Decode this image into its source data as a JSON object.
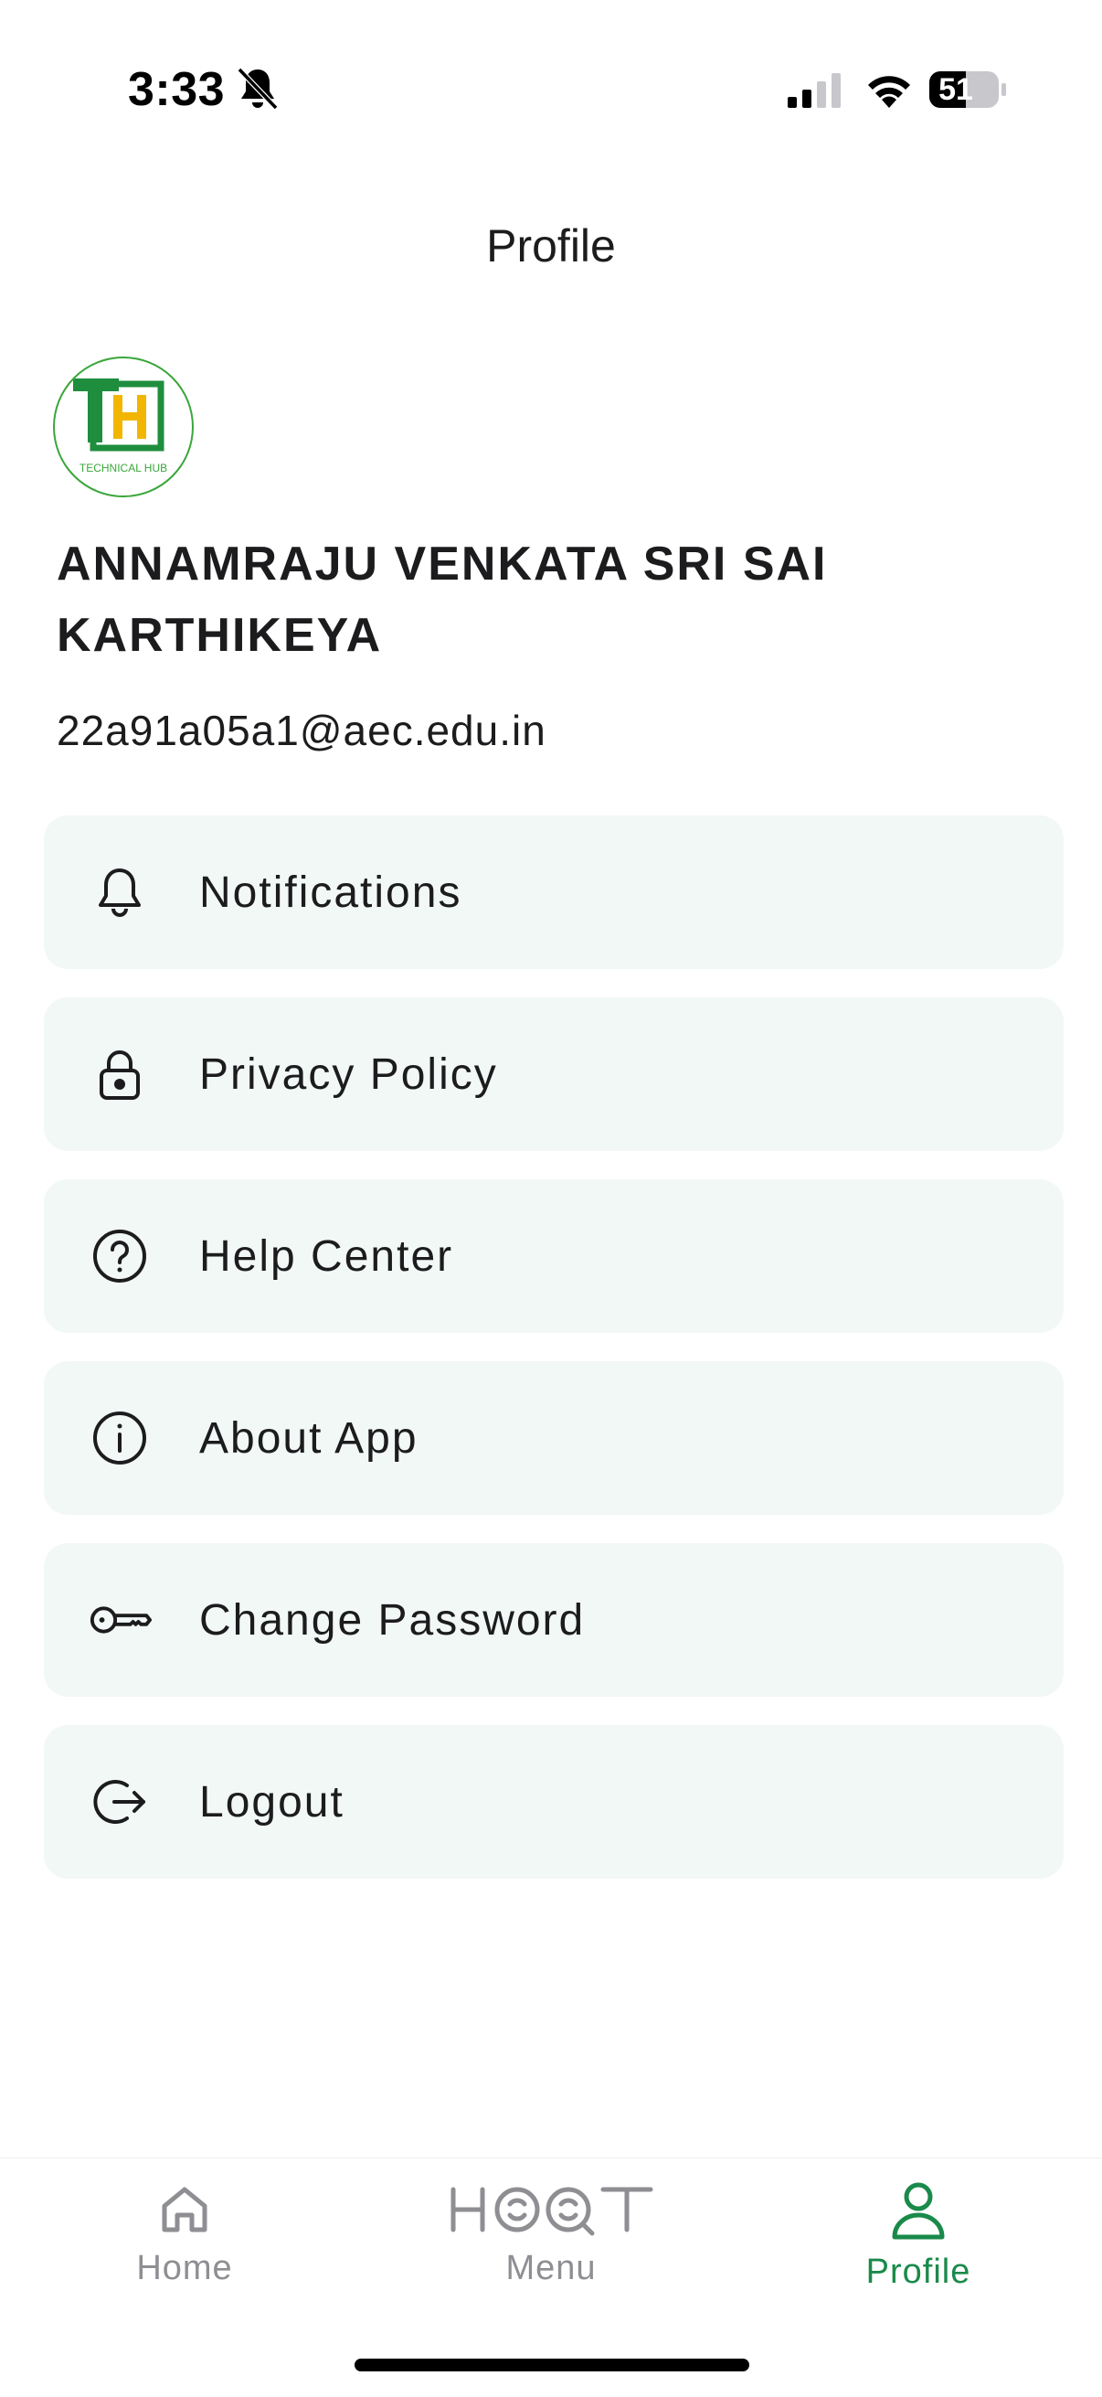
{
  "status_bar": {
    "time": "3:33",
    "battery": "51"
  },
  "header": {
    "title": "Profile"
  },
  "profile": {
    "avatar_logo_text": "TH",
    "avatar_subtext": "TECHNICAL HUB",
    "name": "ANNAMRAJU VENKATA SRI SAI KARTHIKEYA",
    "email": "22a91a05a1@aec.edu.in"
  },
  "menu": {
    "items": [
      {
        "label": "Notifications",
        "icon": "bell-icon"
      },
      {
        "label": "Privacy Policy",
        "icon": "lock-icon"
      },
      {
        "label": "Help Center",
        "icon": "help-circle-icon"
      },
      {
        "label": "About App",
        "icon": "info-icon"
      },
      {
        "label": "Change Password",
        "icon": "key-icon"
      },
      {
        "label": "Logout",
        "icon": "logout-icon"
      }
    ]
  },
  "bottom_nav": {
    "items": [
      {
        "label": "Home",
        "icon": "home-icon",
        "active": false
      },
      {
        "label": "Menu",
        "icon": "hoot-logo-icon",
        "active": false
      },
      {
        "label": "Profile",
        "icon": "user-icon",
        "active": true
      }
    ]
  },
  "colors": {
    "accent": "#1a8a4a",
    "card_bg": "#f2f8f6",
    "inactive": "#8e8e93"
  }
}
